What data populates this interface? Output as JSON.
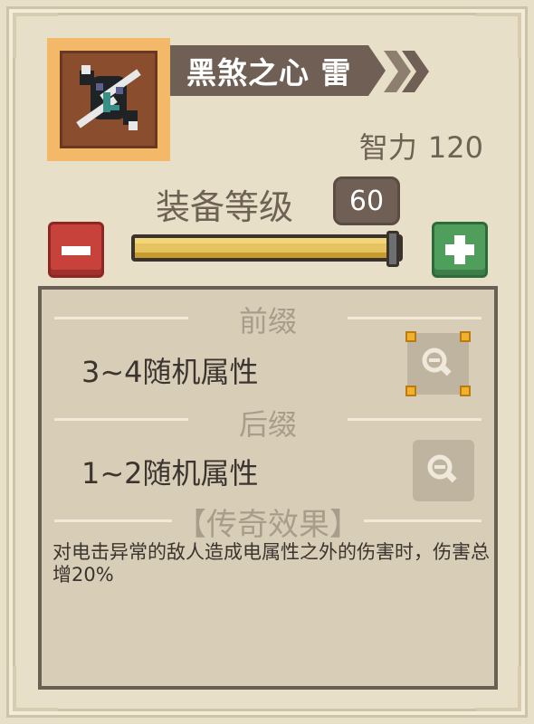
{
  "item": {
    "icon": "dark-heart-weapon-icon",
    "name": "黑煞之心 雷",
    "stat_label": "智力",
    "stat_value": "120"
  },
  "level": {
    "label": "装备等级",
    "value": "60",
    "fill_fraction": 1.0
  },
  "buttons": {
    "minus_icon": "minus-icon",
    "plus_icon": "plus-icon"
  },
  "affixes": {
    "prefix_title": "前缀",
    "prefix_text": "3~4随机属性",
    "suffix_title": "后缀",
    "suffix_text": "1~2随机属性",
    "inspect_icon": "magnifier-icon"
  },
  "legendary": {
    "title": "【传奇效果】",
    "text": "对电击异常的敌人造成电属性之外的伤害时，伤害总增20%"
  },
  "colors": {
    "accent_gold": "#e4c360",
    "minus_red": "#c8423c",
    "plus_green": "#4f9e5c",
    "banner": "#6f5f55"
  }
}
